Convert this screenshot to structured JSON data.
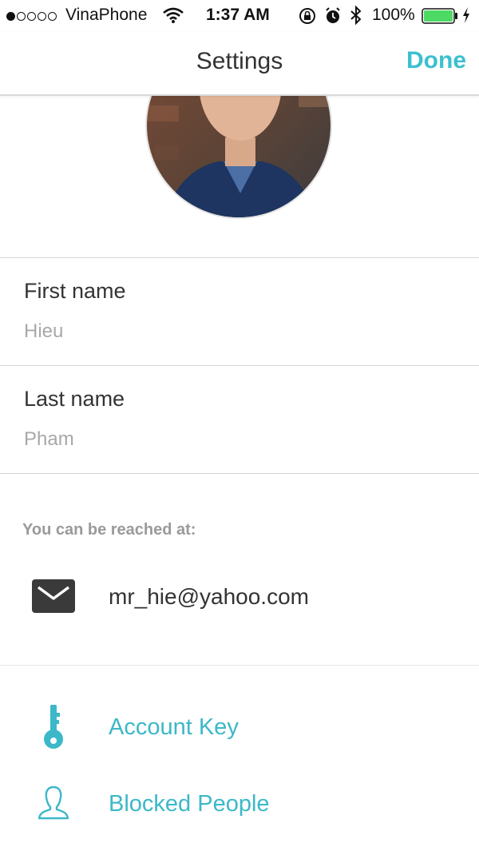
{
  "status_bar": {
    "carrier": "VinaPhone",
    "time": "1:37 AM",
    "battery_percent": "100%",
    "signal_bars_filled": 1,
    "signal_bars_total": 5,
    "battery_level": 1.0
  },
  "nav": {
    "title": "Settings",
    "done_label": "Done"
  },
  "profile": {
    "first_name_label": "First name",
    "first_name_value": "Hieu",
    "last_name_label": "Last name",
    "last_name_value": "Pham"
  },
  "contact": {
    "section_header": "You can be reached at:",
    "email": "mr_hie@yahoo.com",
    "email_icon": "envelope-icon"
  },
  "links": [
    {
      "label": "Account Key",
      "icon": "key-icon"
    },
    {
      "label": "Blocked People",
      "icon": "person-outline-icon"
    }
  ],
  "colors": {
    "accent": "#3cc0d0",
    "text": "#333333",
    "muted": "#a8a8a8"
  }
}
